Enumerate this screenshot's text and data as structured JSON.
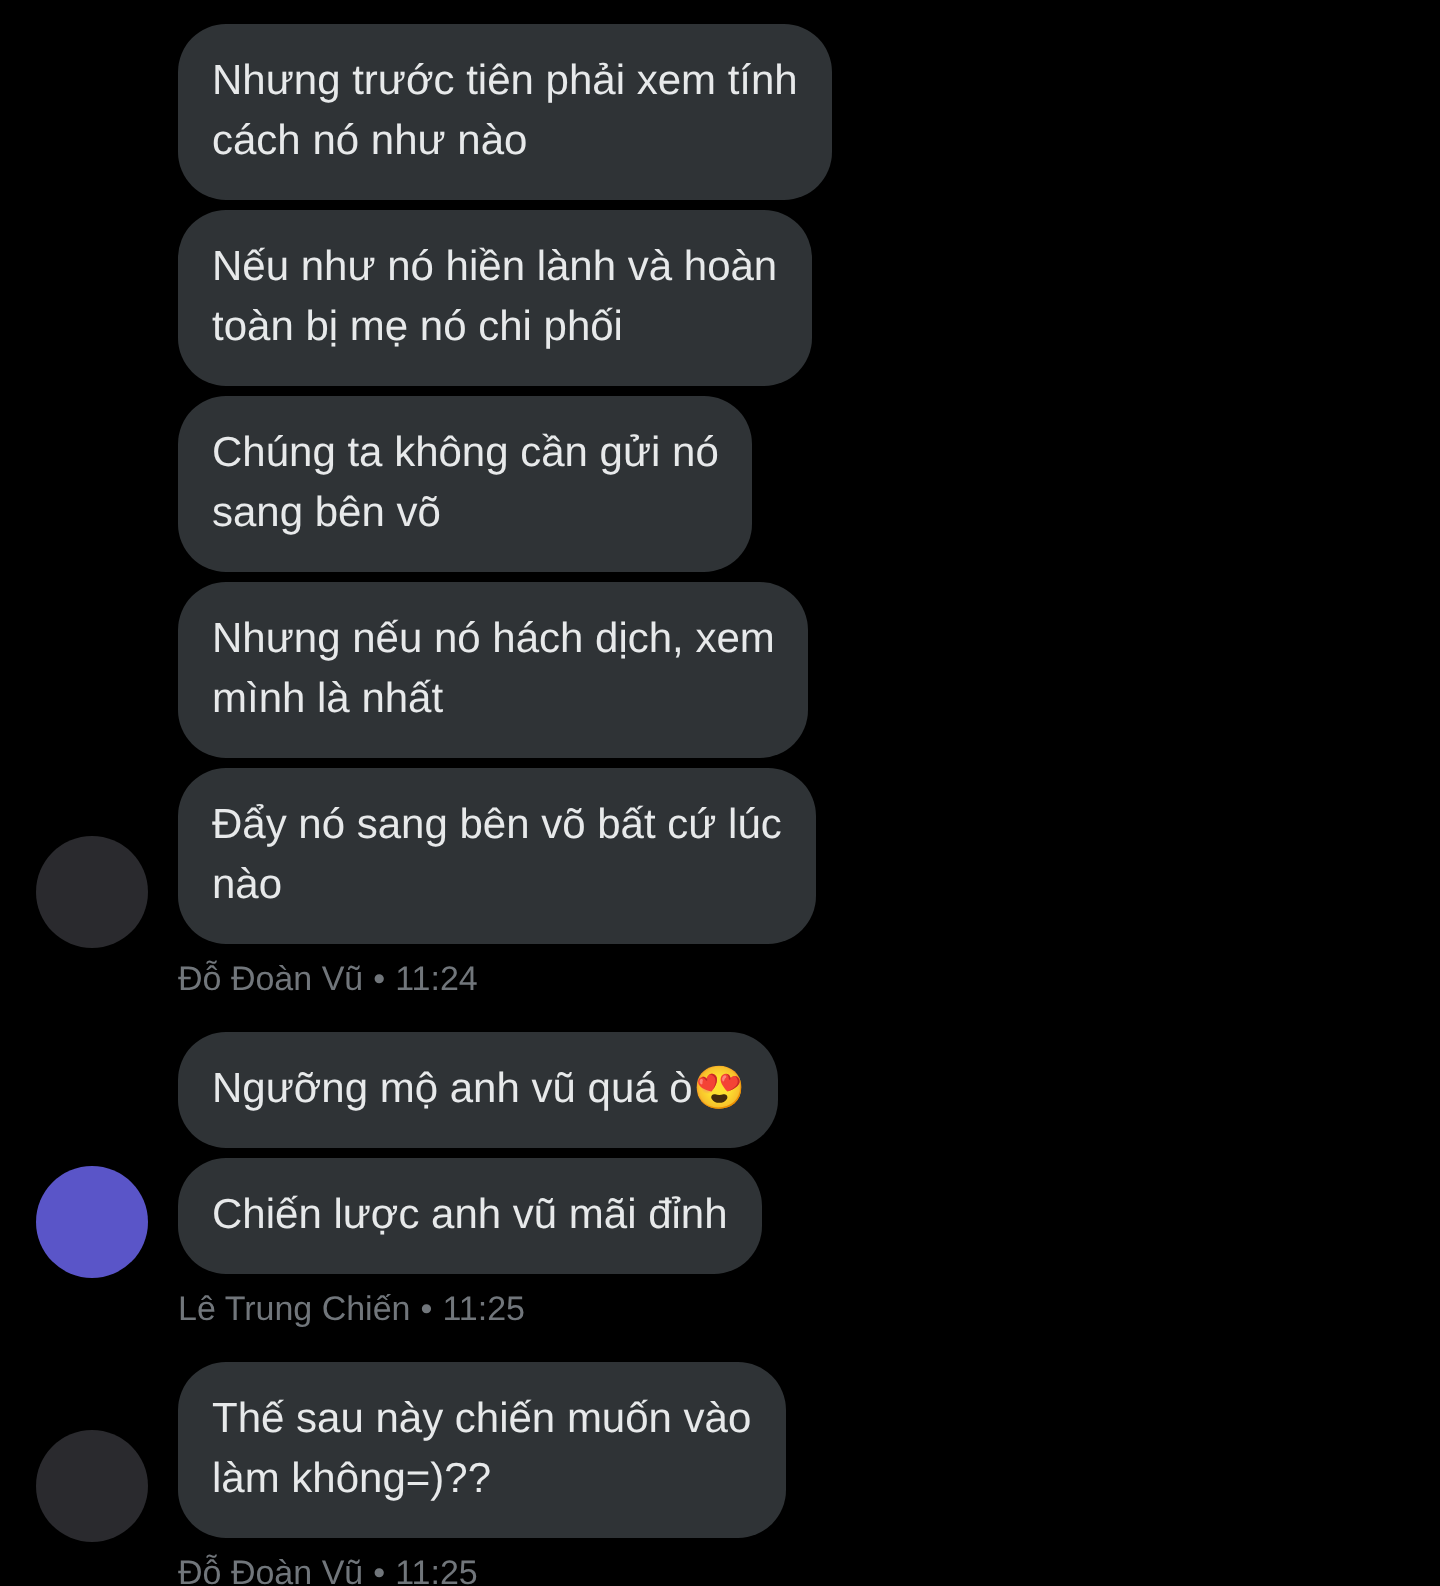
{
  "groups": [
    {
      "sender": "Đỗ Đoàn Vũ",
      "time": "11:24",
      "separator": "•",
      "messages": [
        {
          "lines": [
            "Nhưng trước tiên phải xem tính",
            "cách nó như nào"
          ]
        },
        {
          "lines": [
            "Nếu như nó hiền lành và hoàn",
            "toàn bị mẹ nó chi phối"
          ]
        },
        {
          "lines": [
            "Chúng ta không cần gửi nó",
            "sang bên võ"
          ]
        },
        {
          "lines": [
            "Nhưng nếu nó hách dịch, xem",
            "mình là nhất"
          ]
        },
        {
          "lines": [
            "Đẩy nó sang bên võ bất cứ lúc",
            "nào"
          ]
        }
      ]
    },
    {
      "sender": "Lê Trung Chiến",
      "time": "11:25",
      "separator": "•",
      "messages": [
        {
          "lines": [
            "Ngưỡng mộ anh vũ quá ò😍"
          ]
        },
        {
          "lines": [
            "Chiến lược anh vũ mãi đỉnh"
          ]
        }
      ]
    },
    {
      "sender": "Đỗ Đoàn Vũ",
      "time": "11:25",
      "separator": "•",
      "messages": [
        {
          "lines": [
            "Thế sau này chiến muốn vào",
            "làm không=)??"
          ]
        }
      ]
    }
  ]
}
